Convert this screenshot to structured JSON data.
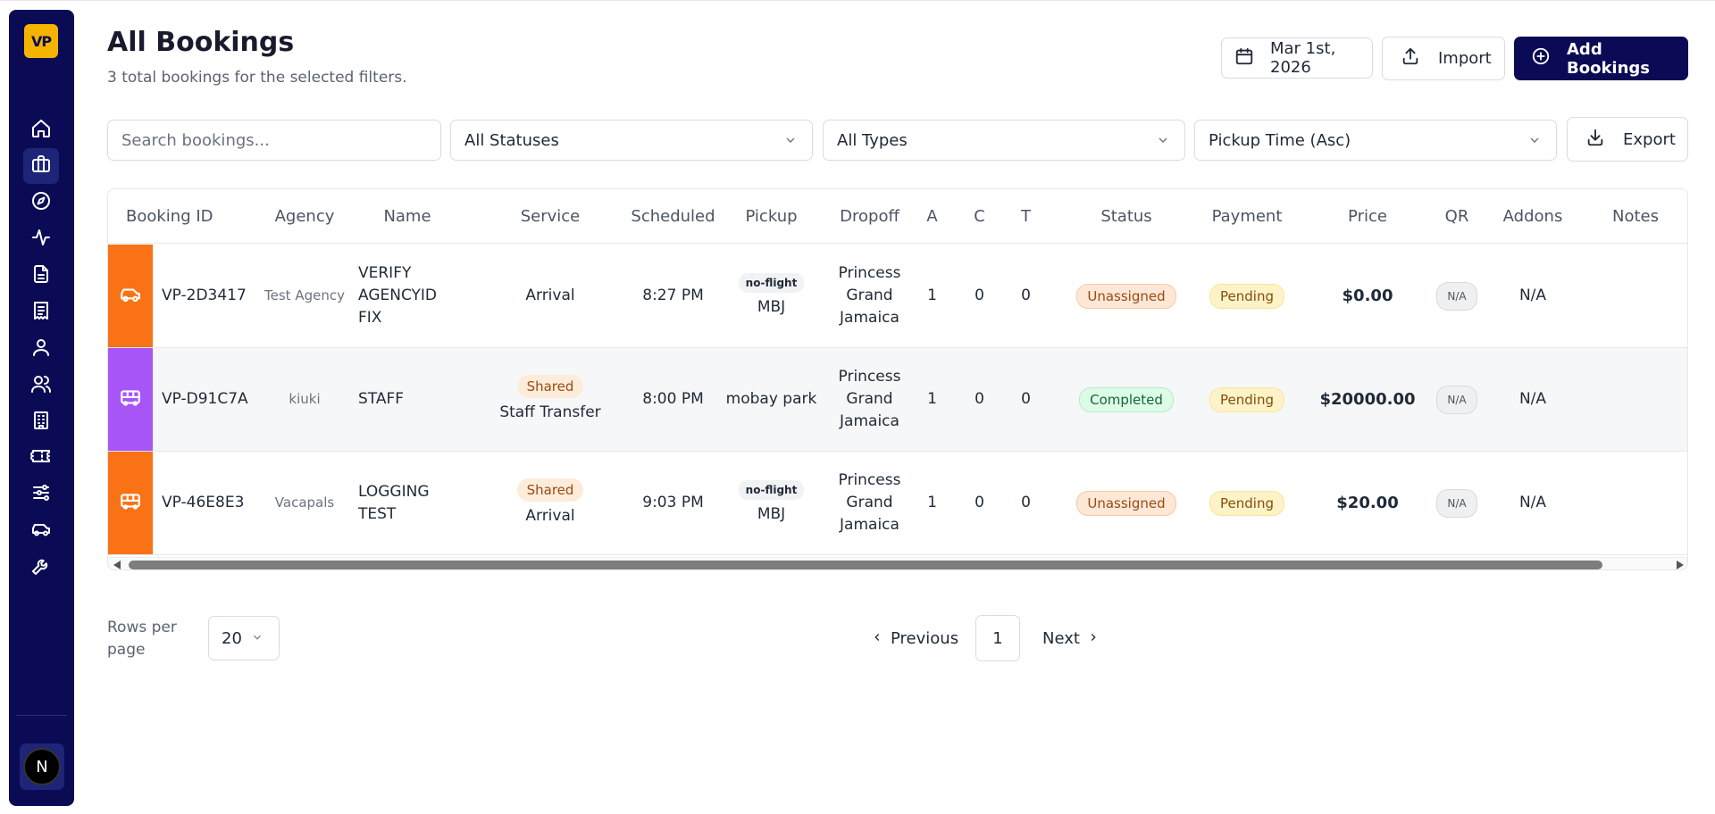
{
  "logo": "VP",
  "nav": [
    {
      "name": "home-icon"
    },
    {
      "name": "briefcase-icon",
      "active": true
    },
    {
      "name": "compass-icon"
    },
    {
      "name": "activity-icon"
    },
    {
      "name": "file-icon"
    },
    {
      "name": "receipt-icon"
    },
    {
      "name": "user-icon"
    },
    {
      "name": "users-icon"
    },
    {
      "name": "building-icon"
    },
    {
      "name": "ticket-icon"
    },
    {
      "name": "sliders-icon"
    },
    {
      "name": "car-icon"
    },
    {
      "name": "wrench-icon"
    }
  ],
  "avatar": "N",
  "header": {
    "title": "All Bookings",
    "subtitle": "3 total bookings for the selected filters.",
    "date_label": "Mar 1st, 2026",
    "import_label": "Import",
    "add_label": "Add Bookings"
  },
  "filters": {
    "search_placeholder": "Search bookings...",
    "status": "All Statuses",
    "types": "All Types",
    "sort": "Pickup Time (Asc)",
    "export_label": "Export"
  },
  "table": {
    "columns": [
      "Booking ID",
      "Agency",
      "Name",
      "Service",
      "Scheduled",
      "Pickup",
      "Dropoff",
      "A",
      "C",
      "T",
      "Status",
      "Payment",
      "Price",
      "QR",
      "Addons",
      "Notes"
    ],
    "rows": [
      {
        "stripe_color": "#f97316",
        "vehicle_icon": "car-icon",
        "id": "VP-2D3417",
        "agency": "Test Agency",
        "name": "VERIFY AGENCYID FIX",
        "service_tag": "",
        "service": "Arrival",
        "scheduled": "8:27 PM",
        "pickup_tag": "no-flight",
        "pickup": "MBJ",
        "dropoff": "Princess Grand Jamaica",
        "a": "1",
        "c": "0",
        "t": "0",
        "status": "Unassigned",
        "payment": "Pending",
        "price": "$0.00",
        "qr": "N/A",
        "addons": "N/A",
        "notes": ""
      },
      {
        "stripe_color": "#a855f7",
        "vehicle_icon": "bus-icon",
        "id": "VP-D91C7A",
        "agency": "kiuki",
        "name": "STAFF",
        "service_tag": "Shared",
        "service": "Staff Transfer",
        "scheduled": "8:00 PM",
        "pickup_tag": "",
        "pickup": "mobay park",
        "dropoff": "Princess Grand Jamaica",
        "a": "1",
        "c": "0",
        "t": "0",
        "status": "Completed",
        "payment": "Pending",
        "price": "$20000.00",
        "qr": "N/A",
        "addons": "N/A",
        "notes": ""
      },
      {
        "stripe_color": "#f97316",
        "vehicle_icon": "bus-icon",
        "id": "VP-46E8E3",
        "agency": "Vacapals",
        "name": "LOGGING TEST",
        "service_tag": "Shared",
        "service": "Arrival",
        "scheduled": "9:03 PM",
        "pickup_tag": "no-flight",
        "pickup": "MBJ",
        "dropoff": "Princess Grand Jamaica",
        "a": "1",
        "c": "0",
        "t": "0",
        "status": "Unassigned",
        "payment": "Pending",
        "price": "$20.00",
        "qr": "N/A",
        "addons": "N/A",
        "notes": ""
      }
    ]
  },
  "pagination": {
    "rows_per_page_label": "Rows per page",
    "rows_per_page": "20",
    "previous": "Previous",
    "current_page": "1",
    "next": "Next"
  }
}
